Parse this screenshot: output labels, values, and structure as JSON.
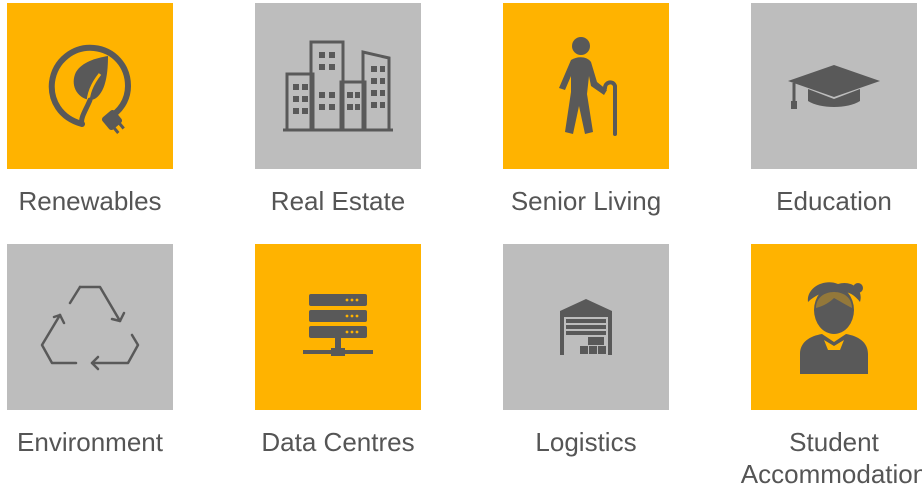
{
  "colors": {
    "accent": "#ffb300",
    "neutral": "#bdbdbd",
    "icon": "#595959",
    "label": "#555555"
  },
  "sectors": [
    {
      "label": "Renewables",
      "icon": "leaf-plug-icon",
      "tile_color": "accent"
    },
    {
      "label": "Real Estate",
      "icon": "buildings-icon",
      "tile_color": "neutral"
    },
    {
      "label": "Senior Living",
      "icon": "elderly-person-icon",
      "tile_color": "accent"
    },
    {
      "label": "Education",
      "icon": "graduation-cap-icon",
      "tile_color": "neutral"
    },
    {
      "label": "Environment",
      "icon": "recycle-icon",
      "tile_color": "neutral"
    },
    {
      "label": "Data Centres",
      "icon": "server-stack-icon",
      "tile_color": "accent"
    },
    {
      "label": "Logistics",
      "icon": "warehouse-icon",
      "tile_color": "neutral"
    },
    {
      "label": "Student\nAccommodation",
      "icon": "student-icon",
      "tile_color": "accent"
    }
  ]
}
